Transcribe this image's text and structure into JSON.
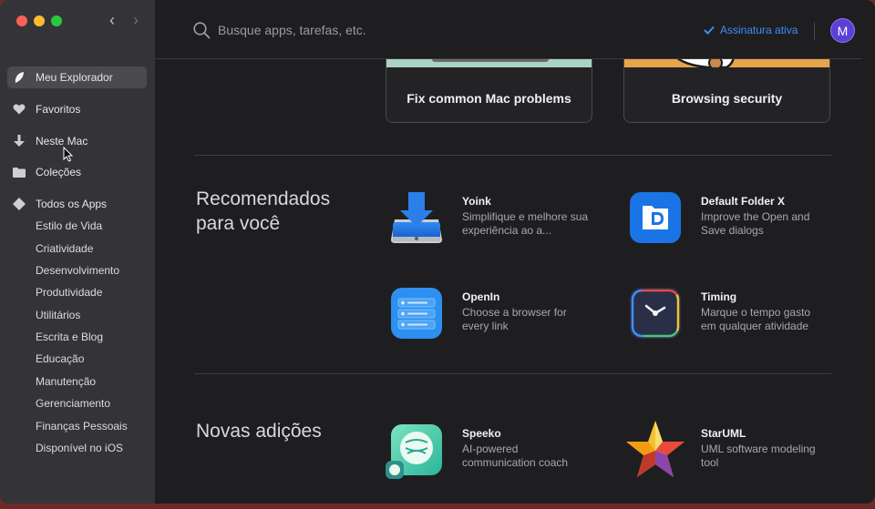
{
  "window": {
    "nav_back": "‹",
    "nav_forward": "›"
  },
  "sidebar": {
    "main_items": [
      {
        "label": "Meu Explorador",
        "icon": "leaf-icon",
        "active": true
      },
      {
        "label": "Favoritos",
        "icon": "heart-icon"
      },
      {
        "label": "Neste Mac",
        "icon": "download-arrow-icon"
      },
      {
        "label": "Coleções",
        "icon": "folder-icon"
      },
      {
        "label": "Todos os Apps",
        "icon": "diamond-icon"
      }
    ],
    "categories": [
      "Estilo de Vida",
      "Criatividade",
      "Desenvolvimento",
      "Produtividade",
      "Utilitários",
      "Escrita e Blog",
      "Educação",
      "Manutenção",
      "Gerenciamento",
      "Finanças Pessoais",
      "Disponível no iOS"
    ]
  },
  "header": {
    "search_placeholder": "Busque apps, tarefas, etc.",
    "subscription_status": "Assinatura ativa",
    "avatar_initial": "M",
    "accent_color": "#3d8ef7"
  },
  "cards": [
    {
      "title": "Fix common Mac problems"
    },
    {
      "title": "Browsing security"
    }
  ],
  "sections": {
    "recommended": {
      "title_line1": "Recomendados",
      "title_line2": "para você",
      "apps": [
        {
          "name": "Yoink",
          "desc": "Simplifique e melhore sua experiência ao a...",
          "icon": "yoink-icon"
        },
        {
          "name": "Default Folder X",
          "desc": "Improve the Open and Save dialogs",
          "icon": "default-folder-x-icon"
        },
        {
          "name": "OpenIn",
          "desc": "Choose a browser for every link",
          "icon": "openin-icon"
        },
        {
          "name": "Timing",
          "desc": "Marque o tempo gasto em qualquer atividade",
          "icon": "timing-icon"
        }
      ]
    },
    "new": {
      "title": "Novas adições",
      "apps": [
        {
          "name": "Speeko",
          "desc": "AI-powered communication coach",
          "icon": "speeko-icon"
        },
        {
          "name": "StarUML",
          "desc": "UML software modeling tool",
          "icon": "staruml-icon"
        }
      ]
    }
  }
}
